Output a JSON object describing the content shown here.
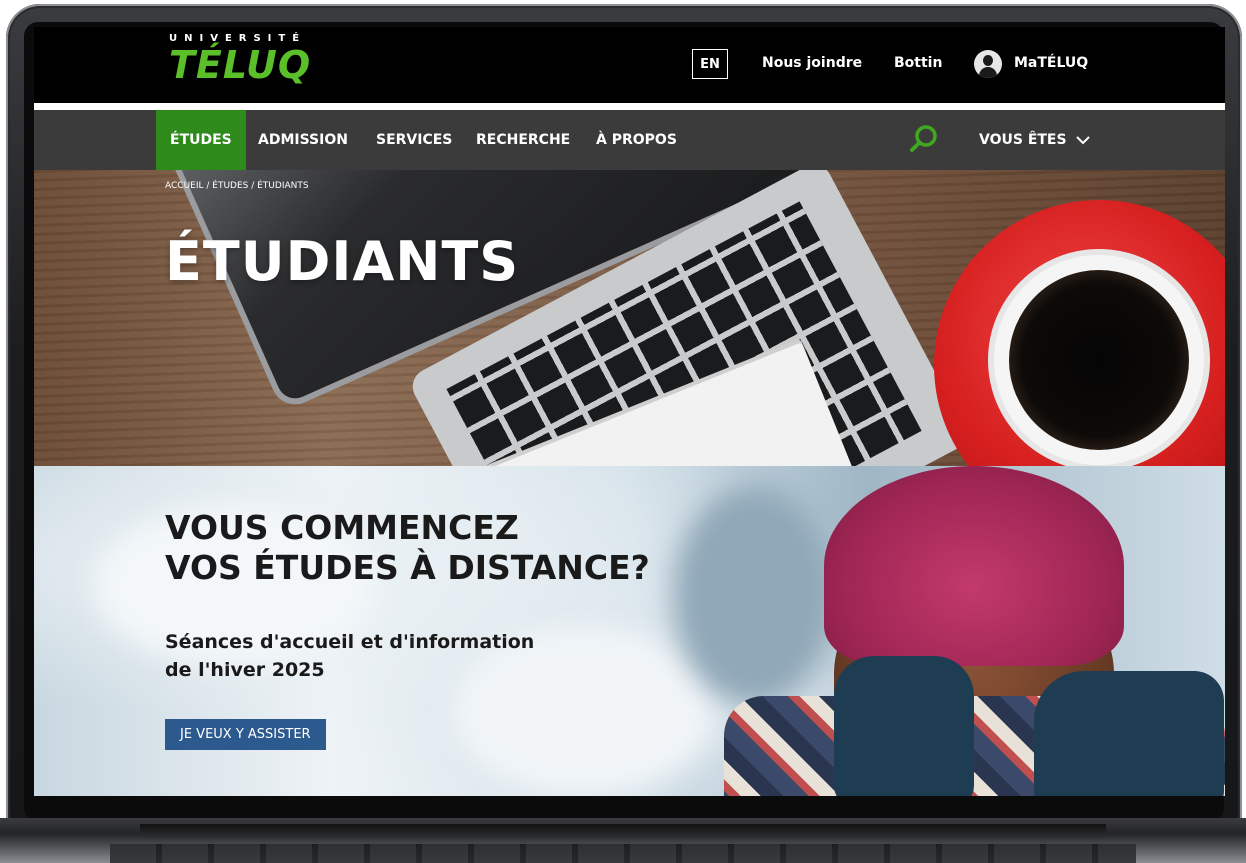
{
  "logo": {
    "univ": "UNIVERSITÉ",
    "name": "TÉLUQ",
    "accent": "#5bbf2a"
  },
  "topbar": {
    "lang": "EN",
    "links": [
      "Nous joindre",
      "Bottin"
    ],
    "account_label": "MaTÉLUQ",
    "account_icon": "user-avatar-icon"
  },
  "nav": {
    "items": [
      "ÉTUDES",
      "ADMISSION",
      "SERVICES",
      "RECHERCHE",
      "À PROPOS"
    ],
    "active": "ÉTUDES",
    "active_color": "#2f8a1c",
    "search_icon": "search-icon",
    "audience_label": "VOUS ÊTES",
    "audience_icon": "chevron-down-icon"
  },
  "hero": {
    "breadcrumb": "ACCUEIL / ÉTUDES / ÉTUDIANTS",
    "title": "ÉTUDIANTS"
  },
  "banner": {
    "heading_line1": "VOUS COMMENCEZ",
    "heading_line2": "VOS ÉTUDES À DISTANCE?",
    "sub_line1": "Séances d'accueil et d'information",
    "sub_line2": "de l'hiver 2025",
    "cta": "JE VEUX Y ASSISTER",
    "cta_color": "#2d5a8e"
  }
}
